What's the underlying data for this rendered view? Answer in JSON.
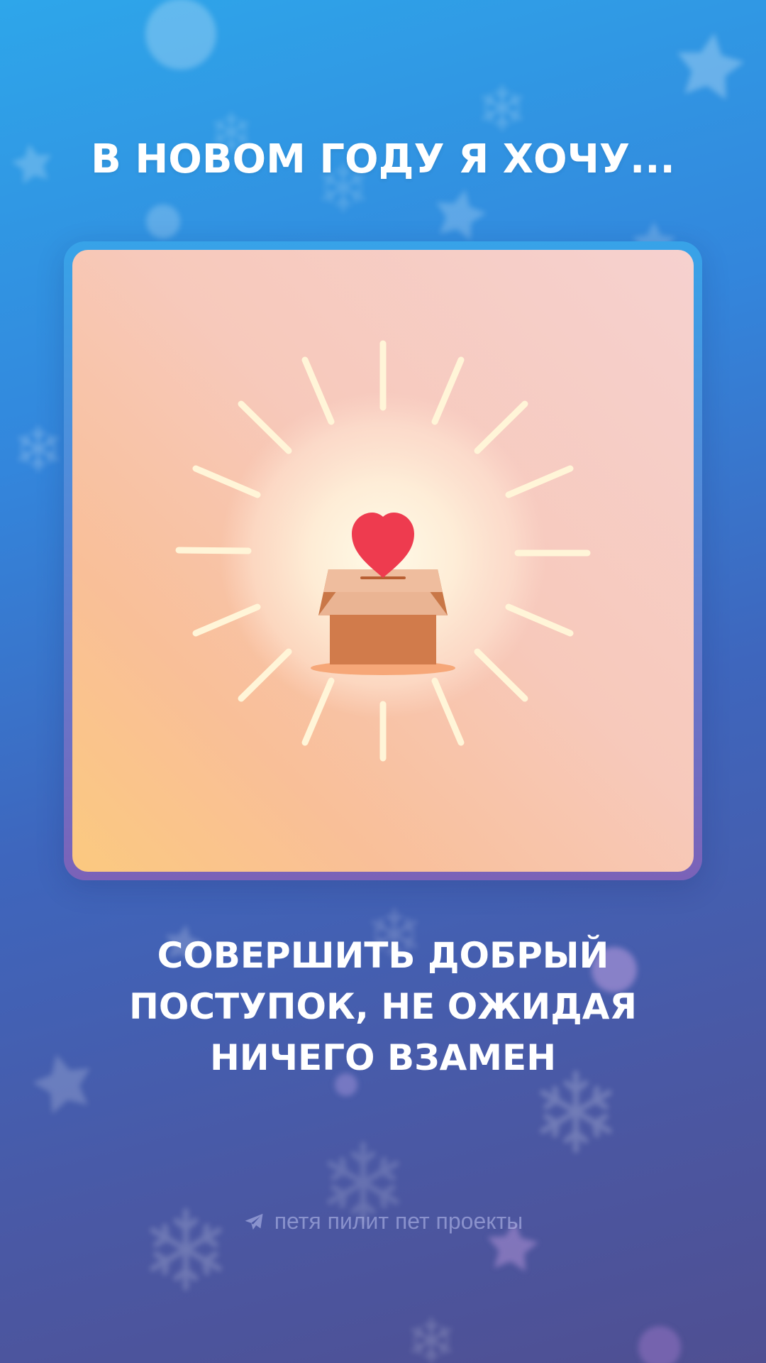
{
  "title": "В НОВОМ ГОДУ Я ХОЧУ...",
  "subtitle": {
    "line1": "СОВЕРШИТЬ ДОБРЫЙ",
    "line2": "ПОСТУПОК, НЕ ОЖИДАЯ",
    "line3": "НИЧЕГО ВЗАМЕН"
  },
  "footer": {
    "icon": "telegram-plane-icon",
    "text": "петя пилит пет проекты"
  },
  "card": {
    "illustration": "donation-box-heart-icon"
  },
  "colors": {
    "heart": "#ee3b4f",
    "box": "#d17b4b",
    "rays": "#fff6dc"
  }
}
